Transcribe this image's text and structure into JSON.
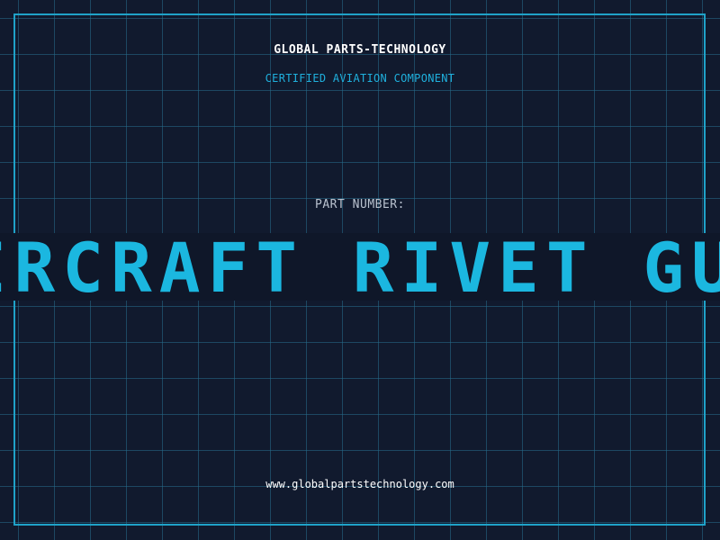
{
  "header": {
    "company": "GLOBAL PARTS-TECHNOLOGY",
    "tagline": "CERTIFIED AVIATION COMPONENT"
  },
  "part": {
    "label": "PART NUMBER:",
    "value": "AIRCRAFT RIVET GUN PA"
  },
  "footer": {
    "url": "www.globalpartstechnology.com"
  },
  "colors": {
    "background": "#111a2e",
    "grid": "#266e8c",
    "accent": "#1bb7e0",
    "text": "#ffffff",
    "muted": "#b9c2cf"
  }
}
